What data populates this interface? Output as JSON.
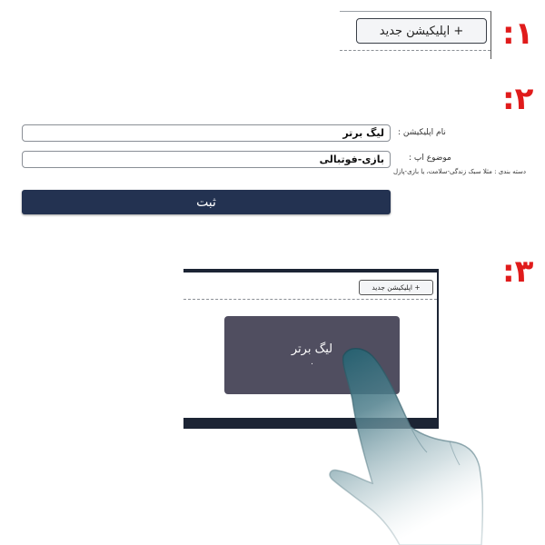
{
  "steps": {
    "one": "۱:",
    "two": "۲:",
    "three": "۳:"
  },
  "step1": {
    "new_app_button": "+ اپلیکیشن جدید"
  },
  "step2": {
    "app_name_label": "نام اپلیکیشن :",
    "app_name_value": "لیگ برتر",
    "topic_label": "موضوع اپ :",
    "topic_value": "بازی-فوتبالی",
    "topic_hint": "دسته بندی : مثلا سبک زندگی-سلامت، یا بازی-پازل",
    "submit_label": "ثبت"
  },
  "step3": {
    "new_app_button": "+ اپلیکیشن جدید",
    "card_title": "لیگ برتر",
    "card_count": "۰"
  },
  "colors": {
    "step_number": "#e01b1b",
    "submit_bg": "#233251",
    "card_bg": "#504e60",
    "screen_frame": "#1c2434"
  }
}
